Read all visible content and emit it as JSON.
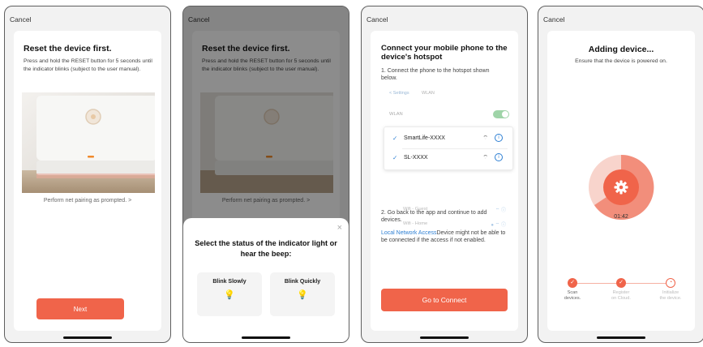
{
  "colors": {
    "accent": "#f0644a",
    "link": "#2d7fd3",
    "bulb": "#f5b82e",
    "background": "#f2f2f2"
  },
  "screen1": {
    "cancel": "Cancel",
    "title": "Reset the device first.",
    "description": "Press and hold the RESET button for 5 seconds until the indicator blinks (subject to the user manual).",
    "pair_link": "Perform net pairing as prompted. >",
    "next_button": "Next"
  },
  "screen2": {
    "cancel": "Cancel",
    "title": "Reset the device first.",
    "description": "Press and hold the RESET button for 5 seconds until the indicator blinks (subject to the user manual).",
    "pair_link": "Perform net pairing as prompted. >",
    "sheet": {
      "close": "×",
      "title": "Select the status of the indicator light or hear the beep:",
      "options": [
        {
          "label": "Blink Slowly",
          "icon": "bulb-icon"
        },
        {
          "label": "Blink Quickly",
          "icon": "bulb-icon"
        }
      ]
    }
  },
  "screen3": {
    "cancel": "Cancel",
    "title": "Connect your mobile phone to the device's hotspot",
    "step1": "1. Connect the phone to the hotspot shown below.",
    "settings": {
      "back": "< Settings",
      "title": "WLAN",
      "wlan_label": "WLAN",
      "highlighted": [
        {
          "name": "SmartLife-XXXX"
        },
        {
          "name": "SL-XXXX"
        }
      ],
      "others": [
        {
          "name": "Wifi - Guest"
        },
        {
          "name": "Wifi - Home"
        }
      ]
    },
    "step2": "2. Go back to the app and continue to add devices.",
    "access_link": "Local Network Access",
    "access_text": "Device might not be able to be connected if the access if not enabled.",
    "goto_button": "Go to Connect"
  },
  "screen4": {
    "cancel": "Cancel",
    "title": "Adding device...",
    "subtitle": "Ensure that the device is powered on.",
    "timer": "01:42",
    "steps": [
      {
        "label_line1": "Scan",
        "label_line2": "devices.",
        "status": "done"
      },
      {
        "label_line1": "Register",
        "label_line2": "on Cloud.",
        "status": "done"
      },
      {
        "label_line1": "Initialize",
        "label_line2": "the device.",
        "status": "pending"
      }
    ]
  }
}
